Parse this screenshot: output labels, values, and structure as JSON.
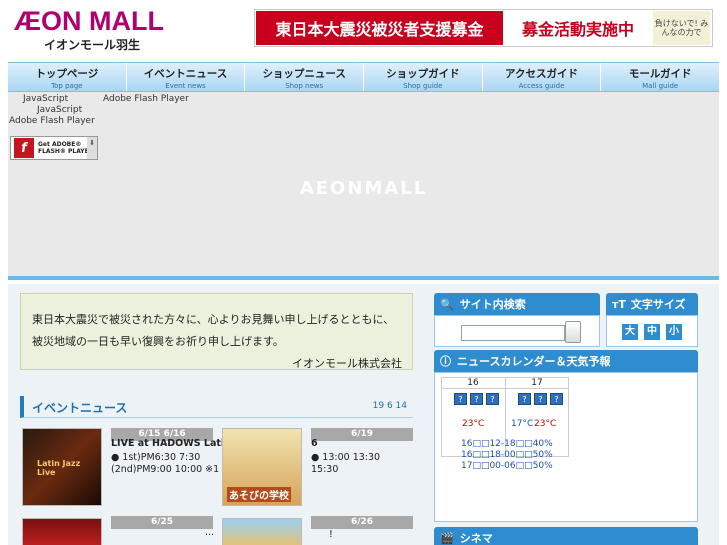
{
  "header": {
    "logo": "ÆON MALL",
    "logo_sub": "イオンモール羽生",
    "banner": {
      "left": "東日本大震災被災者支援募金",
      "middle": "募金活動実施中",
      "right": "負けないで! みんなの力で"
    }
  },
  "nav": [
    {
      "jp": "トップページ",
      "en": "Top page"
    },
    {
      "jp": "イベントニュース",
      "en": "Event news"
    },
    {
      "jp": "ショップニュース",
      "en": "Shop news"
    },
    {
      "jp": "ショップガイド",
      "en": "Shop guide"
    },
    {
      "jp": "アクセスガイド",
      "en": "Access guide"
    },
    {
      "jp": "モールガイド",
      "en": "Mall guide"
    }
  ],
  "flash": {
    "line1a": "JavaScript",
    "line1b": "Adobe Flash Player",
    "line2": "JavaScript",
    "line3": "Adobe Flash Player",
    "get_flash_top": "Get ADOBE®",
    "get_flash_bottom": "FLASH® PLAYER",
    "center_logo": "AEONMALL"
  },
  "message": {
    "line1": "東日本大震災で被災された方々に、心よりお見舞い申し上げるとともに、",
    "line2": "被災地域の一日も早い復興をお祈り申し上げます。",
    "signature": "イオンモール株式会社"
  },
  "events": {
    "title": "イベントニュース",
    "nums": "19   6   14",
    "items": [
      {
        "date": "6/15  6/16",
        "title": "LIVE at HADOWS   Lati...",
        "line2": "●          1st)PM6:30  7:30",
        "line3": "(2nd)PM9:00  10:00 ※1",
        "image": "Latin Jazz Live"
      },
      {
        "date": "6/19",
        "title": "6",
        "line2": "●          13:00        13:30",
        "line3": "15:30",
        "image": "あそびの学校"
      },
      {
        "date": "6/25",
        "title": "...",
        "line2": "",
        "line3": "",
        "image": ""
      },
      {
        "date": "6/26",
        "title": "!",
        "line2": "",
        "line3": "",
        "image": ""
      }
    ]
  },
  "search": {
    "title": "サイト内検索"
  },
  "text_size": {
    "title": "文字サイズ",
    "large": "大",
    "medium": "中",
    "small": "小"
  },
  "calendar": {
    "title": "ニュースカレンダー＆天気予報",
    "days": [
      "16",
      "17"
    ],
    "temps": {
      "d16": "23°C",
      "d17_low": "17°C",
      "d17_high": "23°C"
    },
    "rain": [
      "16□□12-18□□40%",
      "16□□18-00□□50%",
      "17□□00-06□□50%"
    ]
  },
  "cinema": {
    "title": "シネマ"
  }
}
